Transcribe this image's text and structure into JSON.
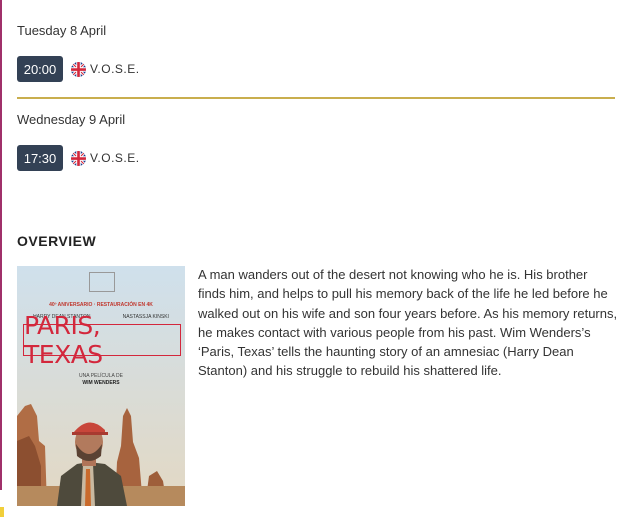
{
  "showtimes": [
    {
      "day": "Tuesday 8 April",
      "time": "20:00",
      "language": "V.O.S.E."
    },
    {
      "day": "Wednesday 9 April",
      "time": "17:30",
      "language": "V.O.S.E."
    }
  ],
  "overview": {
    "title": "OVERVIEW",
    "poster": {
      "subtitle": "40º ANIVERSARIO · RESTAURACIÓN EN 4K",
      "actor1": "HARRY DEAN STANTON",
      "actor2": "NASTASSJA KINSKI",
      "film_title": "PARIS, TEXAS",
      "credit_line": "UNA PELÍCULA DE",
      "director": "WIM WENDERS"
    },
    "text": "A man wanders out of the desert not knowing who he is. His brother finds him, and helps to pull his memory back of the life he led before he walked out on his wife and son four years before. As his memory returns, he makes contact with various people from his past. Wim Wenders’s ‘Paris, Texas’ tells the haunting story of an amnesiac (Harry Dean Stanton) and his struggle to rebuild his shattered life."
  },
  "colors": {
    "time_button": "#334155",
    "divider": "#c9ae4e",
    "accent_bar": "#a0306a"
  },
  "icons": {
    "language_flag": "uk-flag-icon"
  }
}
